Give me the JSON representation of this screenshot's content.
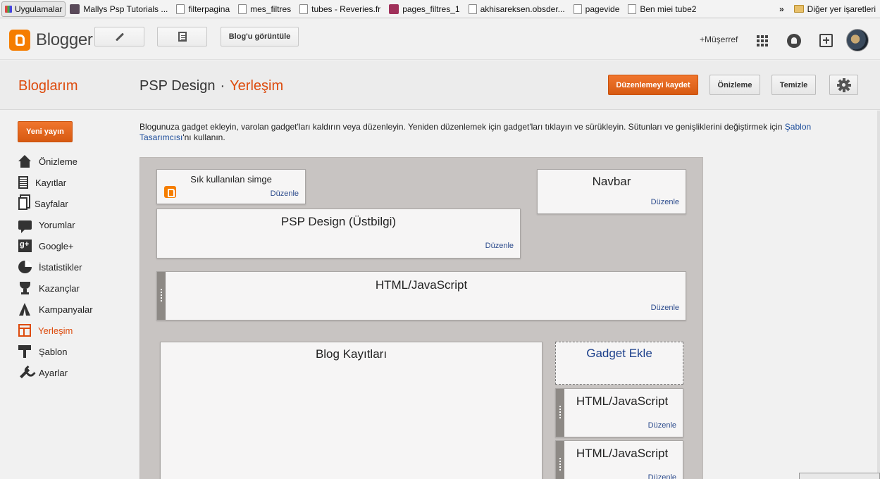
{
  "bookmarks": {
    "items": [
      {
        "label": "Uygulamalar",
        "icon": "apps-icon"
      },
      {
        "label": "Mallys Psp Tutorials ...",
        "icon": "favicon-icon"
      },
      {
        "label": "filterpagina",
        "icon": "page-icon"
      },
      {
        "label": "mes_filtres",
        "icon": "page-icon"
      },
      {
        "label": "tubes - Reveries.fr",
        "icon": "page-icon"
      },
      {
        "label": "pages_filtres_1",
        "icon": "favicon-icon"
      },
      {
        "label": "akhisareksen.obsder...",
        "icon": "page-icon"
      },
      {
        "label": "pagevide",
        "icon": "page-icon"
      },
      {
        "label": "Ben miei tube2",
        "icon": "page-icon"
      }
    ],
    "more": "»",
    "other_bookmarks": "Diğer yer işaretleri"
  },
  "topbar": {
    "logo_text": "Blogger",
    "view_blog_label": "Blog'u görüntüle",
    "user_link": "+Müşerref"
  },
  "header": {
    "my_blogs": "Bloglarım",
    "blog_name": "PSP Design",
    "separator": "·",
    "section": "Yerleşim",
    "save_label": "Düzenlemeyi kaydet",
    "preview_label": "Önizleme",
    "clear_label": "Temizle"
  },
  "sidebar": {
    "new_post": "Yeni yayın",
    "items": [
      {
        "label": "Önizleme",
        "icon": "home-icon"
      },
      {
        "label": "Kayıtlar",
        "icon": "posts-icon"
      },
      {
        "label": "Sayfalar",
        "icon": "pages-icon"
      },
      {
        "label": "Yorumlar",
        "icon": "comments-icon"
      },
      {
        "label": "Google+",
        "icon": "google-plus-icon"
      },
      {
        "label": "İstatistikler",
        "icon": "stats-icon"
      },
      {
        "label": "Kazançlar",
        "icon": "trophy-icon"
      },
      {
        "label": "Kampanyalar",
        "icon": "campaign-icon"
      },
      {
        "label": "Yerleşim",
        "icon": "layout-icon",
        "active": true
      },
      {
        "label": "Şablon",
        "icon": "template-icon"
      },
      {
        "label": "Ayarlar",
        "icon": "wrench-icon"
      }
    ]
  },
  "main": {
    "intro_text": "Blogunuza gadget ekleyin, varolan gadget'ları kaldırın veya düzenleyin. Yeniden düzenlemek için gadget'ları tıklayın ve sürükleyin. Sütunları ve genişliklerini değiştirmek için",
    "intro_link": "Şablon Tasarımcısı",
    "intro_suffix": "'nı kullanın.",
    "edit_label": "Düzenle",
    "widgets": {
      "favicon": "Sık kullanılan simge",
      "navbar": "Navbar",
      "header": "PSP Design (Üstbilgi)",
      "html1": "HTML/JavaScript",
      "blog_posts": "Blog Kayıtları",
      "add_gadget": "Gadget Ekle",
      "html2": "HTML/JavaScript",
      "html3": "HTML/JavaScript"
    }
  },
  "colors": {
    "accent": "#dd4b0d",
    "button_orange": "#e8681e",
    "link_blue": "#1a4b9a"
  }
}
